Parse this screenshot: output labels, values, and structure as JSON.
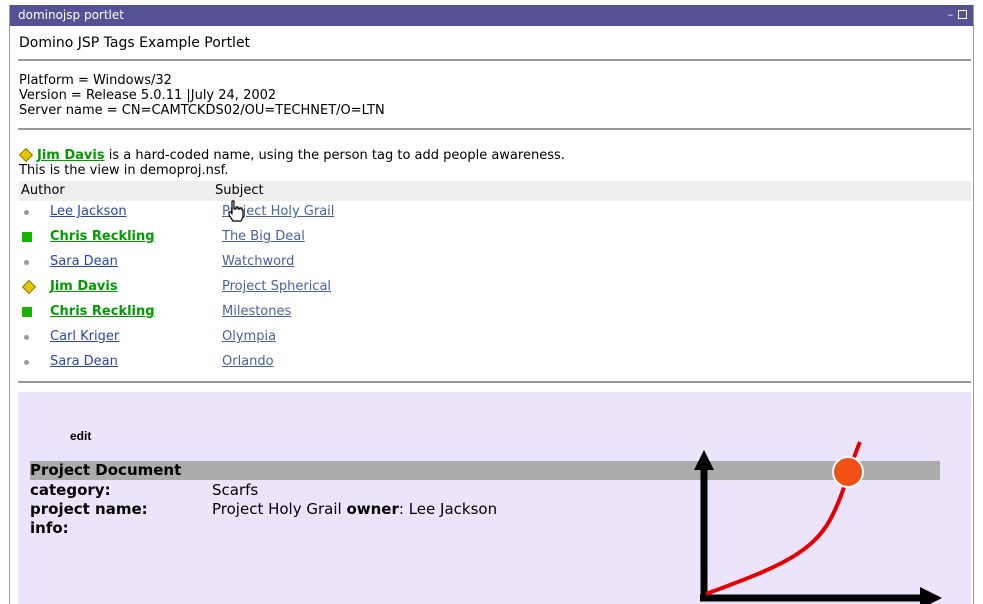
{
  "window": {
    "title": "dominojsp portlet"
  },
  "portlet": {
    "title": "Domino JSP Tags Example Portlet"
  },
  "platform_info": {
    "platform": "Platform = Windows/32",
    "version": "Version = Release 5.0.11 |July 24, 2002",
    "server": "Server name = CN=CAMTCKDS02/OU=TECHNET/O=LTN"
  },
  "note": {
    "person": "Jim Davis",
    "text": "is a hard-coded name, using the person tag to add people awareness.",
    "view_text": "This is the view in demoproj.nsf."
  },
  "table": {
    "columns": [
      "Author",
      "Subject"
    ],
    "rows": [
      {
        "author": "Lee Jackson",
        "status": "offline",
        "subject": "Project Holy Grail"
      },
      {
        "author": "Chris Reckling",
        "status": "online",
        "subject": "The Big Deal"
      },
      {
        "author": "Sara Dean",
        "status": "offline",
        "subject": "Watchword"
      },
      {
        "author": "Jim Davis",
        "status": "away",
        "subject": "Project Spherical"
      },
      {
        "author": "Chris Reckling",
        "status": "online",
        "subject": "Milestones"
      },
      {
        "author": "Carl Kriger",
        "status": "offline",
        "subject": "Olympia"
      },
      {
        "author": "Sara Dean",
        "status": "offline",
        "subject": "Orlando"
      }
    ]
  },
  "document": {
    "edit_label": "edit",
    "header": "Project Document",
    "category_label": "category:",
    "category_value": "Scarfs",
    "project_name_label": "project name:",
    "project_name_value": "Project Holy Grail",
    "owner_label": "owner",
    "owner_value": ": Lee Jackson",
    "info_label": "info:"
  },
  "colors": {
    "titlebar": "#525295",
    "online": "#14b400",
    "away": "#e6c800",
    "edit_background": "#ece4fb",
    "curve": "#e60000",
    "marker": "#f05014"
  }
}
